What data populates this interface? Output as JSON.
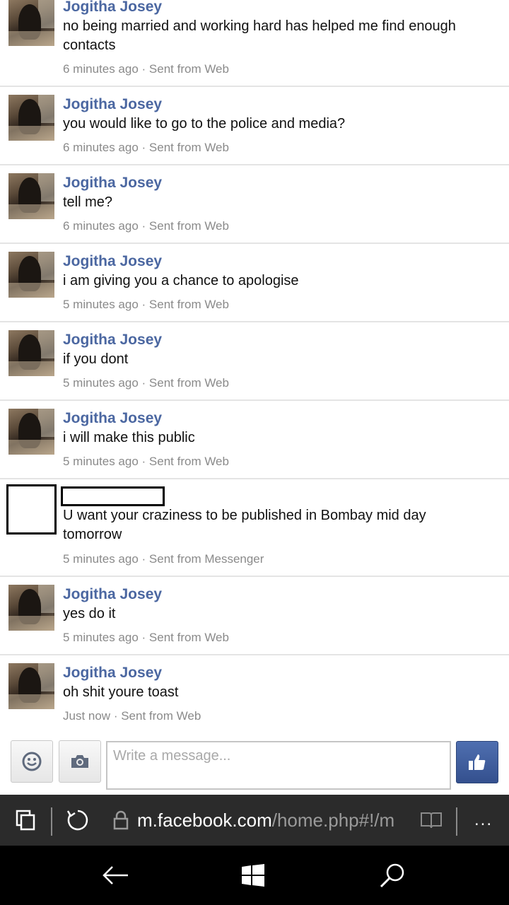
{
  "messages": [
    {
      "sender": "Jogitha Josey",
      "text": "no being married and working hard has helped me find enough contacts",
      "time": "6 minutes ago",
      "source": "Sent from Web"
    },
    {
      "sender": "Jogitha Josey",
      "text": "you would like to go to the police and media?",
      "time": "6 minutes ago",
      "source": "Sent from Web"
    },
    {
      "sender": "Jogitha Josey",
      "text": "tell me?",
      "time": "6 minutes ago",
      "source": "Sent from Web"
    },
    {
      "sender": "Jogitha Josey",
      "text": "i am giving you a chance to apologise",
      "time": "5 minutes ago",
      "source": "Sent from Web"
    },
    {
      "sender": "Jogitha Josey",
      "text": "if you dont",
      "time": "5 minutes ago",
      "source": "Sent from Web"
    },
    {
      "sender": "Jogitha Josey",
      "text": "i will make this public",
      "time": "5 minutes ago",
      "source": "Sent from Web"
    },
    {
      "sender": "",
      "text": "U want your craziness to be published in Bombay mid day tomorrow",
      "time": "5 minutes ago",
      "source": "Sent from Messenger"
    },
    {
      "sender": "Jogitha Josey",
      "text": "yes do it",
      "time": "5 minutes ago",
      "source": "Sent from Web"
    },
    {
      "sender": "Jogitha Josey",
      "text": "oh shit youre toast",
      "time": "Just now",
      "source": "Sent from Web"
    }
  ],
  "composer": {
    "placeholder": "Write a message...",
    "emoji_icon": "smiley-icon",
    "camera_icon": "camera-icon",
    "like_icon": "thumbs-up-icon"
  },
  "browser": {
    "url_host": "m.facebook.com",
    "url_path": "/home.php#!/m",
    "more_label": "..."
  },
  "colors": {
    "sender_name": "#4b67a1",
    "meta_text": "#8a8a8a",
    "like_button": "#3b5998",
    "browser_bar": "#2b2b2b",
    "nav_bar": "#000000"
  }
}
